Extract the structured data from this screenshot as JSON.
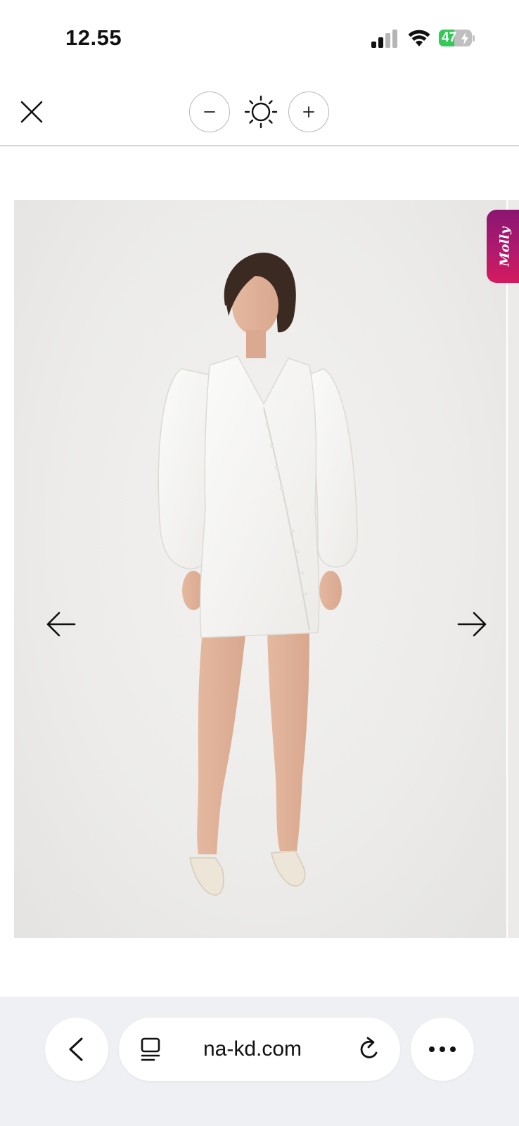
{
  "status_bar": {
    "time": "12.55",
    "battery_level": "47",
    "battery_fraction": 0.47,
    "battery_color": "#34c759",
    "icons": [
      "signal-icon",
      "wifi-icon",
      "battery-icon"
    ]
  },
  "viewer_toolbar": {
    "icons": [
      "close-icon",
      "minus-icon",
      "brightness-icon",
      "plus-icon"
    ]
  },
  "image_viewer": {
    "navigation": [
      "arrow-left-icon",
      "arrow-right-icon"
    ],
    "chat_tab_label": "Molly",
    "chat_tab_colors": [
      "#8a1570",
      "#d41a5e"
    ]
  },
  "browser": {
    "url": "na-kd.com",
    "icons": [
      "chevron-left-icon",
      "tabs-icon",
      "reload-icon",
      "more-icon"
    ]
  }
}
